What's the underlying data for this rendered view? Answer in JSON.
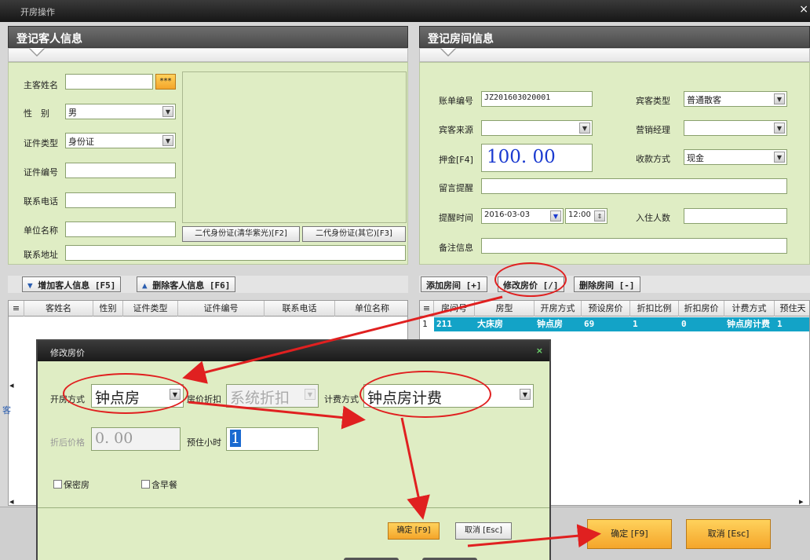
{
  "window": {
    "title": "开房操作",
    "close": "×"
  },
  "guest": {
    "header": "登记客人信息",
    "name_label": "主客姓名",
    "name_value": "",
    "name_btn": "***",
    "gender_label": "性　别",
    "gender_value": "男",
    "id_type_label": "证件类型",
    "id_type_value": "身份证",
    "id_no_label": "证件编号",
    "phone_label": "联系电话",
    "company_label": "单位名称",
    "address_label": "联系地址",
    "idcard_btn1": "二代身份证(清华紫光)[F2]",
    "idcard_btn2": "二代身份证(其它)[F3]",
    "add_btn": "增加客人信息 [F5]",
    "del_btn": "删除客人信息 [F6]",
    "columns": [
      "客姓名",
      "性别",
      "证件类型",
      "证件编号",
      "联系电话",
      "单位名称"
    ],
    "side_label": "客"
  },
  "room": {
    "header": "登记房间信息",
    "bill_label": "账单编号",
    "bill_value": "JZ201603020001",
    "guest_type_label": "宾客类型",
    "guest_type_value": "普通散客",
    "source_label": "宾客来源",
    "source_value": "",
    "manager_label": "营销经理",
    "manager_value": "",
    "deposit_label": "押金[F4]",
    "deposit_value": "100. 00",
    "pay_label": "收款方式",
    "pay_value": "现金",
    "message_label": "留言提醒",
    "remind_label": "提醒时间",
    "remind_date": "2016-03-03",
    "remind_time": "12:00",
    "persons_label": "入住人数",
    "note_label": "备注信息",
    "add_room_btn": "添加房间 [+]",
    "edit_price_btn": "修改房价 [/]",
    "del_room_btn": "删除房间 [-]",
    "columns": [
      "房间号",
      "房型",
      "开房方式",
      "预设房价",
      "折扣比例",
      "折扣房价",
      "计费方式",
      "预住天"
    ],
    "rows": [
      {
        "idx": "1",
        "cells": [
          "211",
          "大床房",
          "钟点房",
          "69",
          "1",
          "0",
          "钟点房计费",
          "1"
        ]
      }
    ]
  },
  "footer": {
    "ok_btn": "确定 [F9]",
    "cancel_btn": "取消 [Esc]"
  },
  "dialog": {
    "title": "修改房价",
    "close": "×",
    "open_mode_label": "开房方式",
    "open_mode_value": "钟点房",
    "discount_label": "房价折扣",
    "discount_value": "系统折扣",
    "billing_label": "计费方式",
    "billing_value": "钟点房计费",
    "after_price_label": "折后价格",
    "after_price_value": "0. 00",
    "hours_label": "预住小时",
    "hours_value": "1",
    "secret_label": "保密房",
    "breakfast_label": "含早餐",
    "ok_btn": "确定 [F9]",
    "cancel_btn": "取消 [Esc]"
  },
  "colors": {
    "form_bg": "#dfedc4",
    "row_selected": "#13a3c7",
    "accent_orange": "#f4a52a",
    "annotation_red": "#e02020"
  }
}
